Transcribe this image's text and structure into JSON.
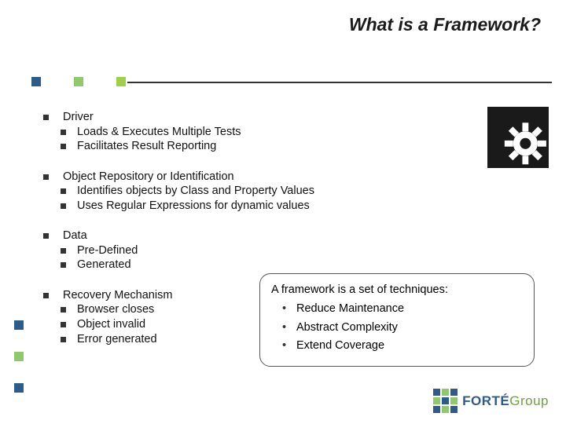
{
  "title": "What is a Framework?",
  "bullets": [
    {
      "label": "Driver",
      "subs": [
        "Loads & Executes Multiple Tests",
        "Facilitates Result Reporting"
      ]
    },
    {
      "label": "Object Repository or Identification",
      "subs": [
        "Identifies objects by Class and Property Values",
        "Uses Regular Expressions for dynamic values"
      ]
    },
    {
      "label": "Data",
      "subs": [
        "Pre-Defined",
        "Generated"
      ]
    },
    {
      "label": "Recovery Mechanism",
      "subs": [
        "Browser closes",
        "Object invalid",
        "Error generated"
      ]
    }
  ],
  "callout": {
    "heading": "A framework is a set of techniques:",
    "points": [
      "Reduce Maintenance",
      "Abstract Complexity",
      "Extend Coverage"
    ]
  },
  "logo": {
    "brand1": "FORTÉ",
    "brand2": "Group"
  }
}
